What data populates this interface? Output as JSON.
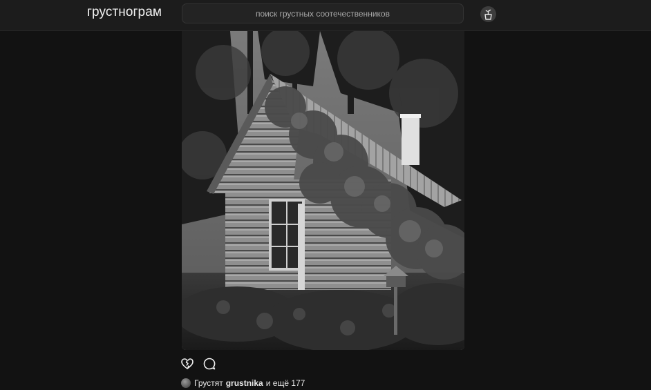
{
  "app": {
    "logo": "грустнограм"
  },
  "search": {
    "placeholder": "поиск грустных соотечественников"
  },
  "header": {
    "profile_icon": "plant-pot-icon"
  },
  "post": {
    "photo_icon": "house-photo",
    "actions": {
      "like_icon": "broken-heart-icon",
      "comment_icon": "speech-bubble-icon"
    },
    "likes": {
      "prefix": "Грустят",
      "username": "grustnika",
      "suffix": "и ещё 177"
    }
  },
  "colors": {
    "background": "#121212",
    "topbar": "#1c1c1c",
    "text": "#f0f0f0",
    "muted": "#a8a8a8"
  }
}
